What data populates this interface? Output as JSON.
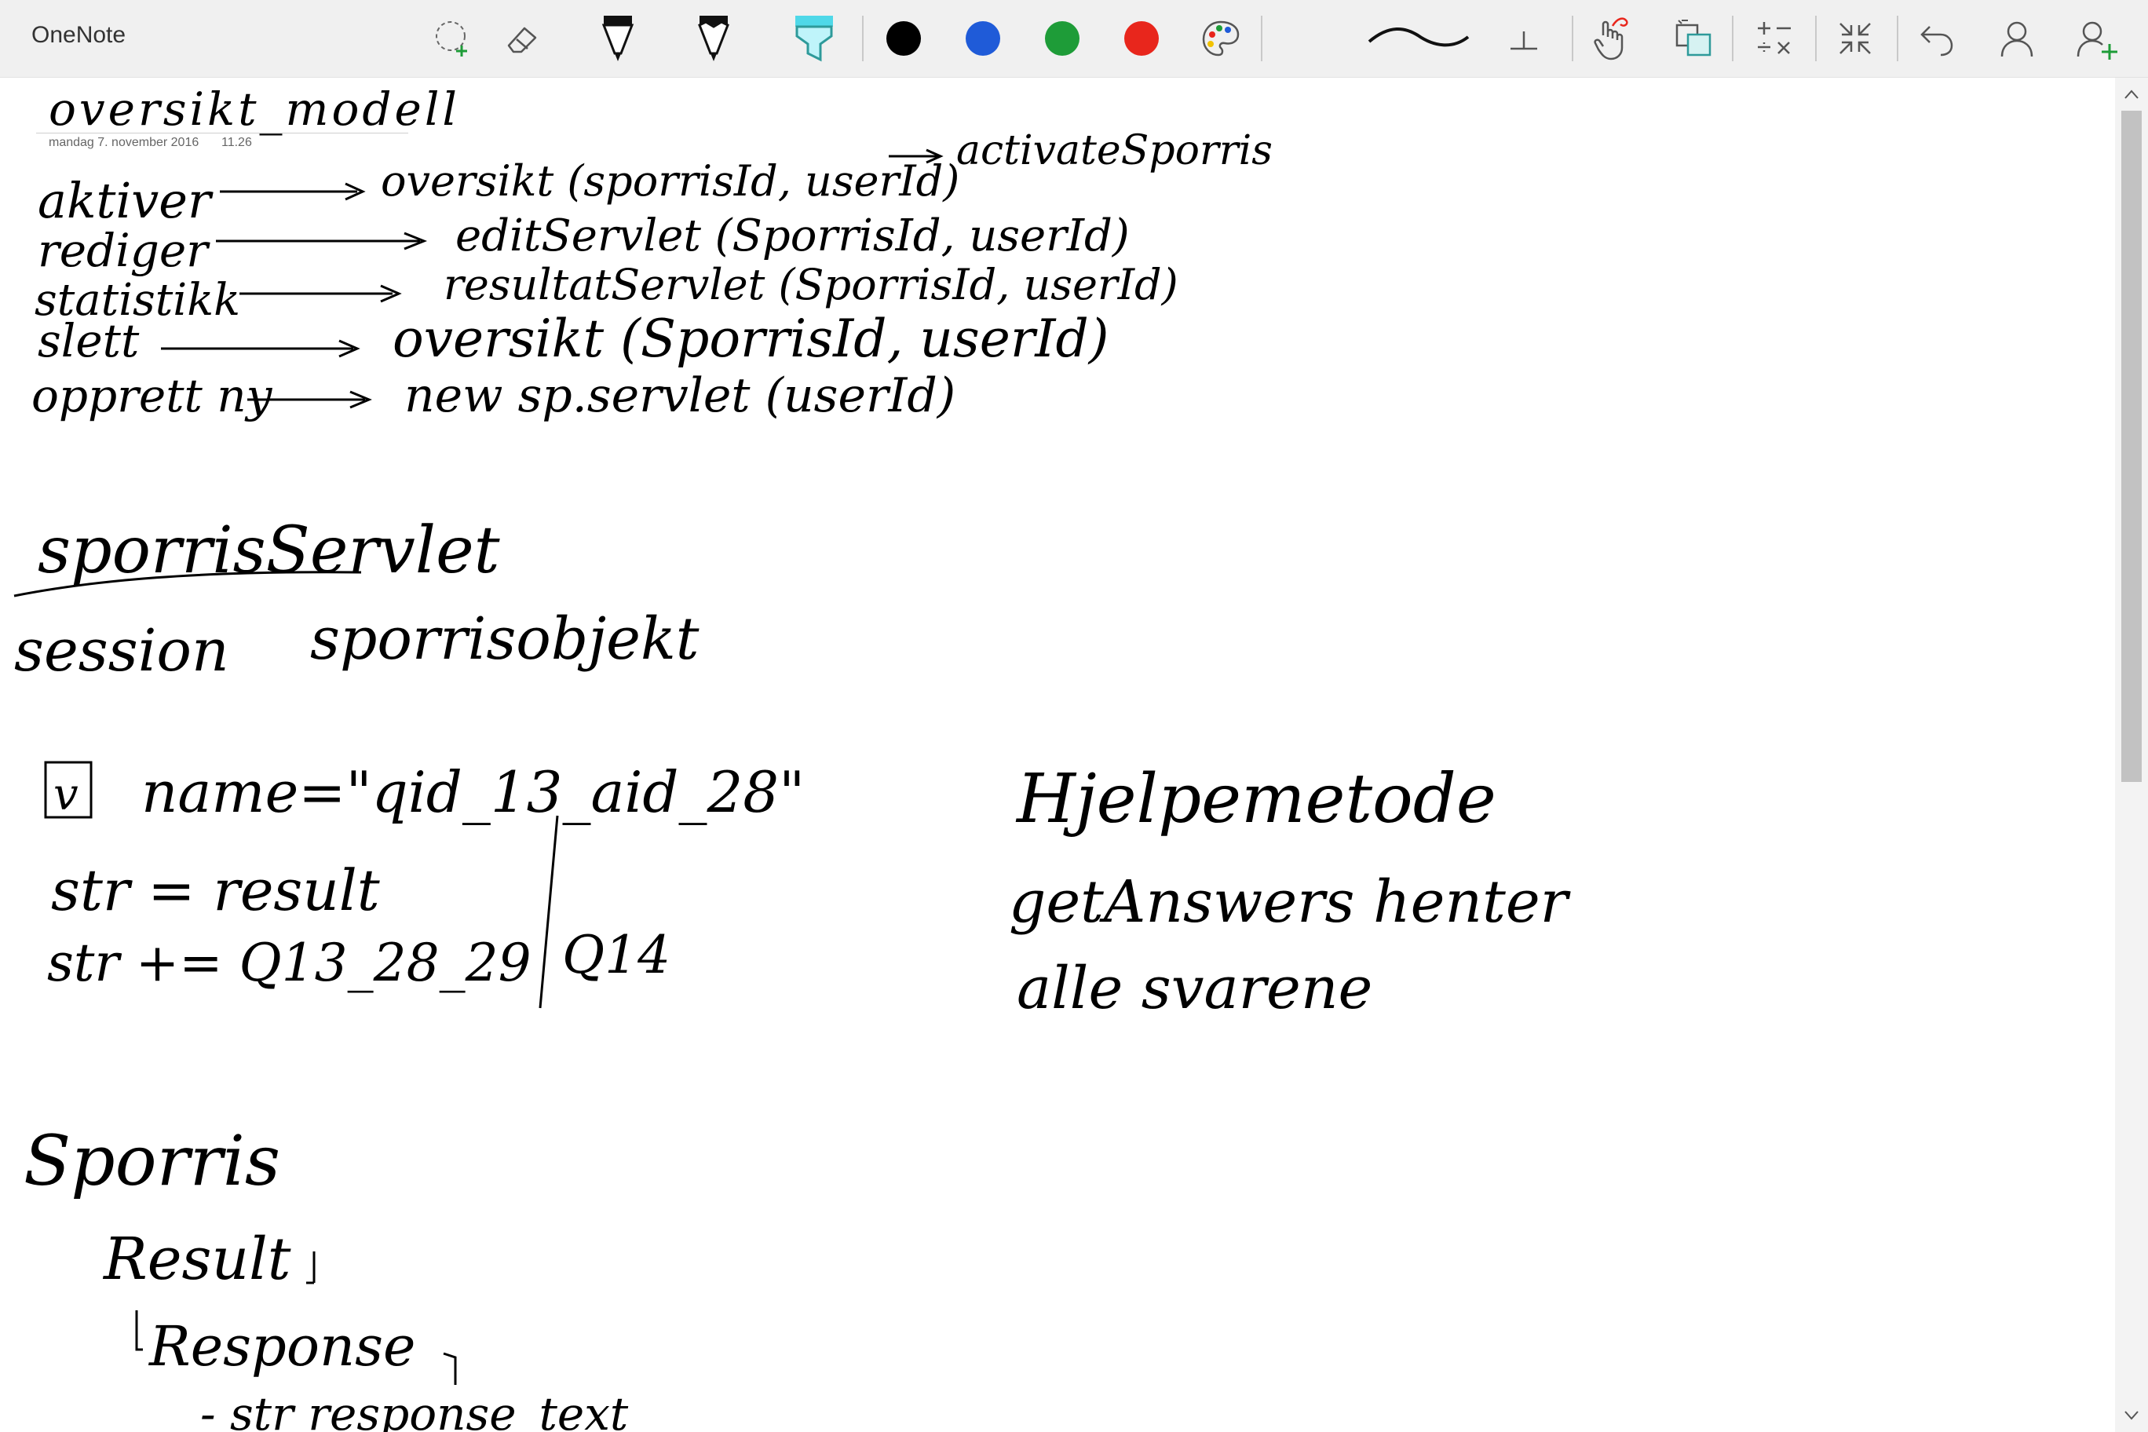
{
  "app": {
    "title": "OneNote"
  },
  "toolbar": {
    "tools": [
      {
        "name": "lasso-select-icon"
      },
      {
        "name": "eraser-icon"
      },
      {
        "name": "pen-icon"
      },
      {
        "name": "pencil-icon"
      },
      {
        "name": "highlighter-icon"
      }
    ],
    "colors": [
      {
        "name": "black",
        "hex": "#000000"
      },
      {
        "name": "blue",
        "hex": "#1f5bd8"
      },
      {
        "name": "green",
        "hex": "#1e9c38"
      },
      {
        "name": "red",
        "hex": "#e8261c"
      }
    ],
    "right_icons": [
      "stroke-width-icon",
      "ruler-icon",
      "touch-writing-icon",
      "ink-to-shape-icon",
      "ink-to-math-icon",
      "collapse-icon",
      "undo-icon",
      "account-icon",
      "add-user-icon"
    ],
    "accent_teal": "#2e9a9a",
    "highlighter_color": "#4fd8e8"
  },
  "page": {
    "title": "oversikt_modell",
    "date": "mandag 7. november 2016",
    "time": "11.26"
  },
  "ink": {
    "row1_left": "aktiver",
    "row1_right": "oversikt (sporrisId, userId)",
    "row1_extra": "activateSporris",
    "row2_left": "rediger",
    "row2_right": "editServlet (SporrisId, userId)",
    "row3_left": "statistikk",
    "row3_right": "resultatServlet (SporrisId, userId)",
    "row4_left": "slett",
    "row4_right": "oversikt (SporrisId, userId)",
    "row5_left": "opprett ny",
    "row5_right": "new sp.servlet (userId)",
    "block2_line1": "sporrisServlet",
    "block2_line2_a": "session",
    "block2_line2_b": "sporrisobjekt",
    "checkbox_mark": "v",
    "name_line": "name=\"qid_13_aid_28\"",
    "str_line1": "str = result",
    "str_line2": "str += Q13_28_29",
    "str_line2_tail": "Q14",
    "helper_title": "Hjelpemetode",
    "helper_line1": "getAnswers henter",
    "helper_line2": "alle svarene",
    "tree_root": "Sporris",
    "tree_child": "Result",
    "tree_grandchild": "Response",
    "tree_leaf": "- str response_text"
  }
}
